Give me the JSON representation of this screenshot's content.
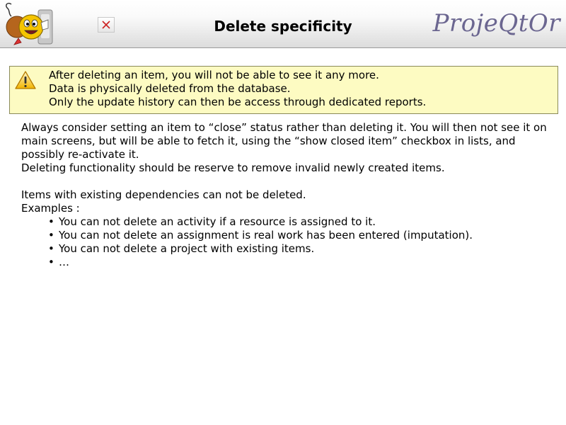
{
  "header": {
    "title": "Delete specificity",
    "brand": "ProjeQtOr",
    "logo_icon": "smiley-mascot-icon",
    "close_icon": "close-x-icon"
  },
  "warning": {
    "icon": "warning-triangle-icon",
    "lines": [
      "After deleting an item, you will not be able to see it any more.",
      "Data is physically deleted from the database.",
      "Only the update history can then be access through dedicated reports."
    ]
  },
  "body": {
    "paragraph1": "Always consider setting an item to “close” status rather than deleting it. You will then not see it on main screens, but will be able to fetch it, using the “show closed item” checkbox in lists, and possibly re-activate it.",
    "paragraph2": "Deleting functionality should be reserve to remove invalid newly created items.",
    "paragraph3": "Items with existing dependencies can not be deleted.",
    "examples_label": "Examples :",
    "examples": [
      "You can not delete an activity if a resource is assigned to it.",
      "You can not delete an assignment is real work has been entered (imputation).",
      "You can not delete a project with existing items.",
      "…"
    ]
  },
  "colors": {
    "warning_background": "#fdfbc2",
    "brand_text": "#6b6690",
    "close_x": "#cc2222"
  }
}
